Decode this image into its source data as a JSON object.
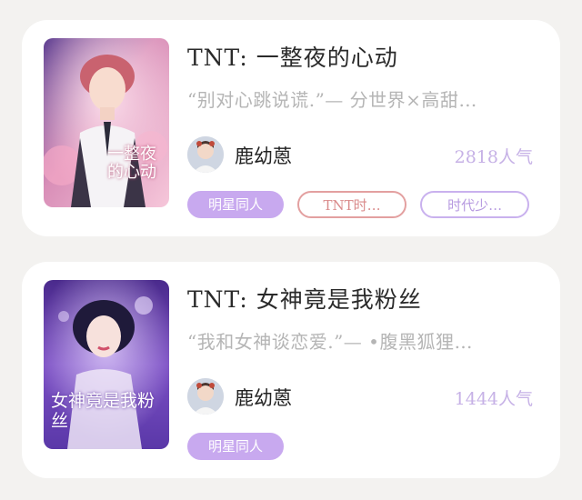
{
  "books": [
    {
      "title": "TNT: 一整夜的心动",
      "description": "“别对心跳说谎.”— 分世界×高甜…",
      "author": "鹿幼蒽",
      "popularity": "2818人气",
      "cover_text": "一整夜的心动",
      "tags": [
        "明星同人",
        "TNT时…",
        "时代少…"
      ]
    },
    {
      "title": "TNT: 女神竟是我粉丝",
      "description": "“我和女神谈恋爱.”— •腹黑狐狸…",
      "author": "鹿幼蒽",
      "popularity": "1444人气",
      "cover_text": "女神竟是我粉丝",
      "tags": [
        "明星同人"
      ]
    }
  ],
  "icons": {
    "cover_1": "book-cover-image",
    "cover_2": "book-cover-image",
    "avatar": "author-avatar"
  },
  "colors": {
    "tag_filled": "#c8a9ef",
    "tag_red_border": "#e3a0a0",
    "tag_purple_border": "#c9b1ee",
    "popularity": "#c6b1e6"
  }
}
